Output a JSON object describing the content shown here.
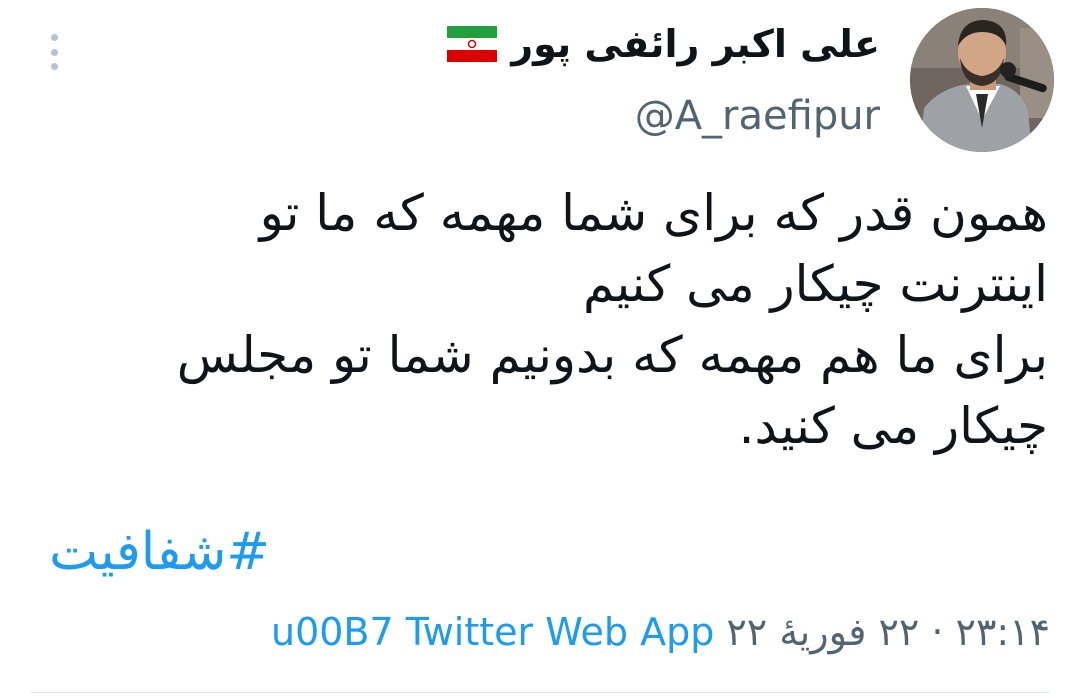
{
  "author": {
    "display_name": "علی اکبر رائفی پور",
    "handle": "@A_raefipur",
    "flag_icon": "iran-flag-icon",
    "avatar": "profile-photo"
  },
  "tweet": {
    "text": "همون قدر که برای شما مهمه که ما تو\nاینترنت چیکار می کنیم\nبرای ما هم مهمه که بدونیم شما تو مجلس\nچیکار می کنید.",
    "hashtag": "#شفافیت",
    "timestamp": "۲۳:۱۴ · ۲۲ فوریهٔ ۲۲",
    "separator": "u00B7",
    "source": "Twitter Web App"
  },
  "colors": {
    "link": "#1d9bf0",
    "secondary_text": "#536471",
    "primary_text": "#0f1419"
  }
}
